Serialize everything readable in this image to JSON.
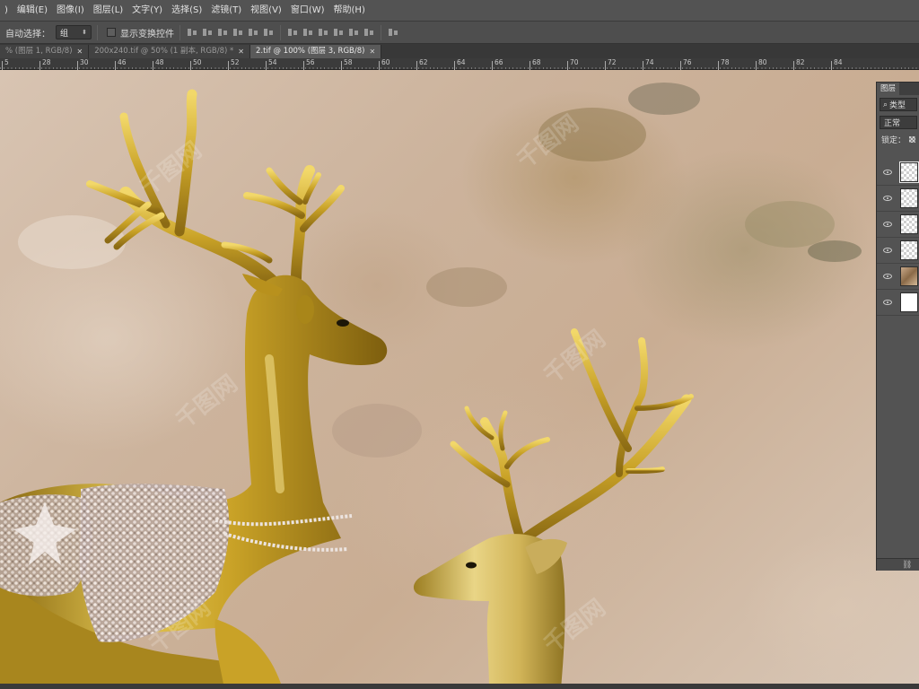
{
  "menu": [
    "编辑(E)",
    "图像(I)",
    "图层(L)",
    "文字(Y)",
    "选择(S)",
    "滤镜(T)",
    "视图(V)",
    "窗口(W)",
    "帮助(H)"
  ],
  "menu_lead": ")",
  "options": {
    "auto_select_label": "自动选择：",
    "auto_select_value": "组",
    "show_transform_label": "显示变换控件"
  },
  "tabs": [
    {
      "label": "% (图层 1, RGB/8)",
      "active": false
    },
    {
      "label": "200x240.tif @ 50% (1 副本, RGB/8) *",
      "active": false
    },
    {
      "label": "2.tif @ 100% (图层 3, RGB/8)",
      "active": true
    }
  ],
  "ruler_labels": [
    "5",
    "28",
    "30",
    "46",
    "48",
    "50",
    "52",
    "54",
    "56",
    "58",
    "60",
    "62",
    "64",
    "66",
    "68",
    "70",
    "72",
    "74",
    "76",
    "78",
    "80",
    "82",
    "84"
  ],
  "watermark_text": "千图网",
  "layers_panel": {
    "tab_label": "图层",
    "filter_label": "类型",
    "blend_mode": "正常",
    "lock_label": "锁定：",
    "layers": [
      {
        "thumb": "transparent",
        "selected": true
      },
      {
        "thumb": "transparent",
        "selected": false
      },
      {
        "thumb": "transparent",
        "selected": false
      },
      {
        "thumb": "transparent",
        "selected": false
      },
      {
        "thumb": "photo",
        "selected": false
      },
      {
        "thumb": "white",
        "selected": false
      }
    ]
  },
  "colors": {
    "ui_background": "#535353",
    "gold": "#c9a227",
    "gold_highlight": "#f2d86a",
    "gold_shadow": "#7d5e0e"
  }
}
